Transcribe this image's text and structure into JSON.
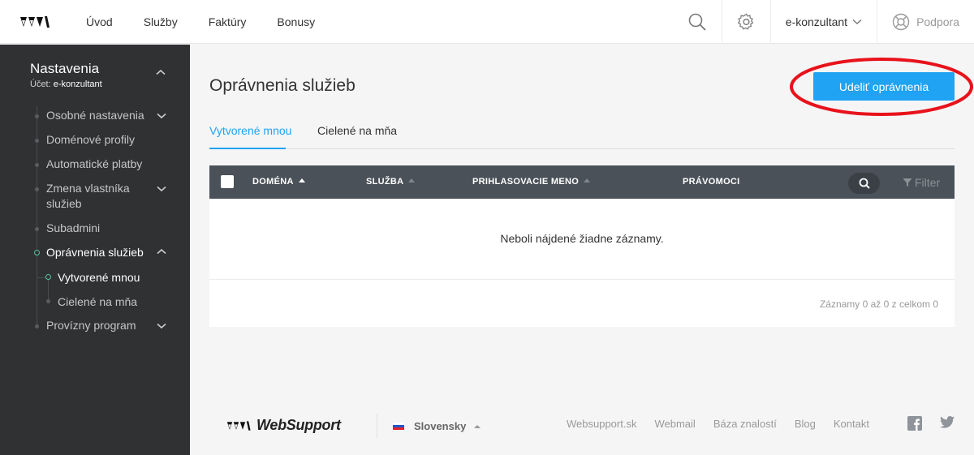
{
  "topbar": {
    "nav": [
      "Úvod",
      "Služby",
      "Faktúry",
      "Bonusy"
    ],
    "account": "e-konzultant",
    "support": "Podpora"
  },
  "sidebar": {
    "title": "Nastavenia",
    "account_prefix": "Účet:",
    "account_name": "e-konzultant",
    "items": [
      {
        "label": "Osobné nastavenia"
      },
      {
        "label": "Doménové profily"
      },
      {
        "label": "Automatické platby"
      },
      {
        "label": "Zmena vlastníka služieb"
      },
      {
        "label": "Subadmini"
      },
      {
        "label": "Oprávnenia služieb"
      },
      {
        "label": "Provízny program"
      }
    ],
    "subitems": [
      {
        "label": "Vytvorené mnou"
      },
      {
        "label": "Cielené na mňa"
      }
    ]
  },
  "main": {
    "title": "Oprávnenia služieb",
    "grant_button": "Udeliť oprávnenia",
    "tabs": [
      "Vytvorené mnou",
      "Cielené na mňa"
    ],
    "table": {
      "columns": [
        "DOMÉNA",
        "SLUŽBA",
        "PRIHLASOVACIE MENO",
        "PRÁVOMOCI"
      ],
      "filter_label": "Filter",
      "empty_text": "Neboli nájdené žiadne záznamy.",
      "records_text": "Záznamy 0 až 0 z celkom 0"
    }
  },
  "footer": {
    "brand": "WebSupport",
    "language": "Slovensky",
    "links": [
      "Websupport.sk",
      "Webmail",
      "Báza znalostí",
      "Blog",
      "Kontakt"
    ]
  },
  "colors": {
    "accent": "#1fa3f2",
    "sidebar_bg": "#2f3133",
    "table_header": "#4a5158",
    "highlight_ring": "#e8121b"
  }
}
